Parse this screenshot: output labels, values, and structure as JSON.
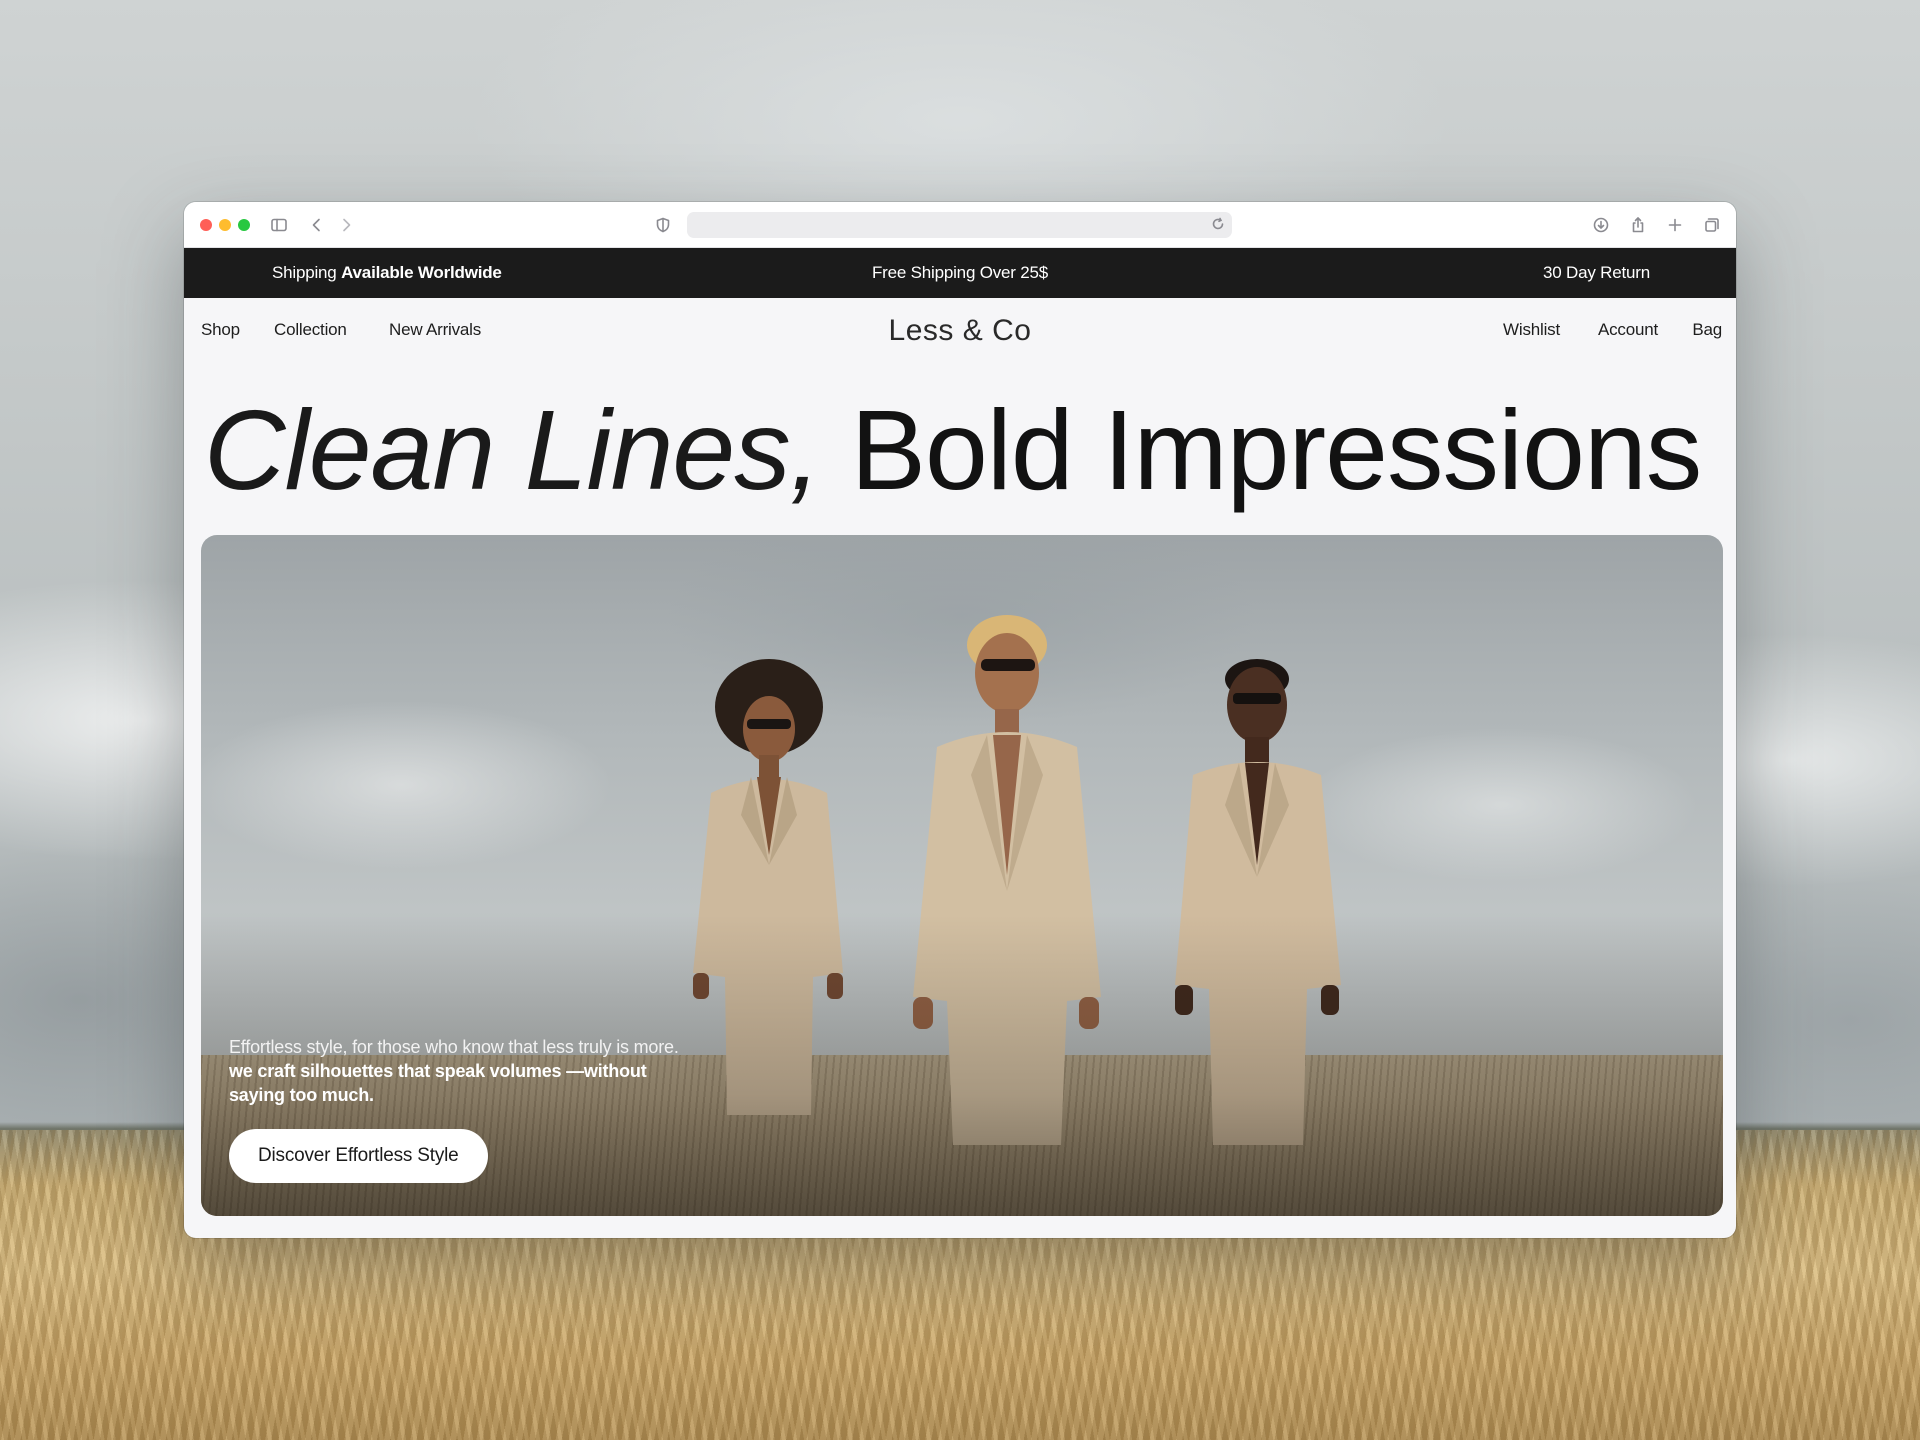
{
  "announcement": {
    "left_prefix": "Shipping",
    "left_bold": "Available Worldwide",
    "center": "Free Shipping Over 25$",
    "right": "30 Day Return"
  },
  "nav": {
    "left": [
      "Shop",
      "Collection",
      "New Arrivals"
    ],
    "logo": "Less & Co",
    "right": [
      "Wishlist",
      "Account",
      "Bag"
    ]
  },
  "hero": {
    "headline_light": "Clean Lines,",
    "headline_bold": "Bold Impressions",
    "copy_regular": "Effortless style, for those who know that less truly is more.",
    "copy_bold": "we craft silhouettes that speak volumes —without saying too much.",
    "cta": "Discover Effortless Style"
  },
  "icons": {
    "sidebar": "sidebar-icon",
    "back": "chevron-left-icon",
    "forward": "chevron-right-icon",
    "privacy": "shield-icon",
    "reload": "reload-icon",
    "download": "download-icon",
    "share": "share-icon",
    "new_tab": "plus-icon",
    "tabs": "tabs-overview-icon"
  },
  "colors": {
    "announcement_bg": "#1b1b1b",
    "page_bg": "#f6f6f8",
    "suit": "#cdb99d"
  }
}
